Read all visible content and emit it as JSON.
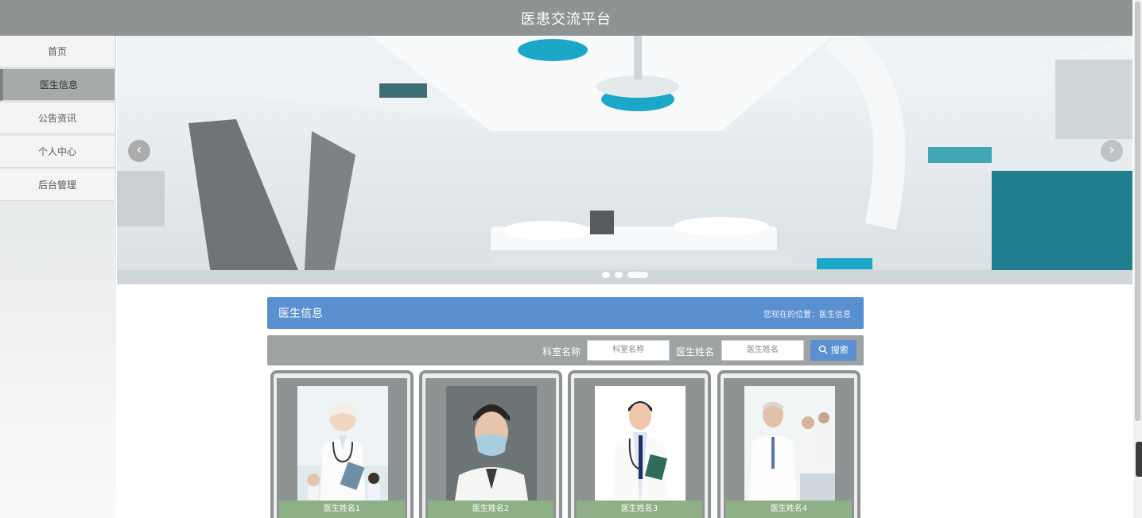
{
  "header": {
    "title": "医患交流平台"
  },
  "sidebar": {
    "items": [
      {
        "label": "首页",
        "active": false
      },
      {
        "label": "医生信息",
        "active": true
      },
      {
        "label": "公告资讯",
        "active": false
      },
      {
        "label": "个人中心",
        "active": false
      },
      {
        "label": "后台管理",
        "active": false
      }
    ]
  },
  "banner": {
    "prev_icon": "chevron-left-icon",
    "next_icon": "chevron-right-icon",
    "slide_count": 3,
    "active_slide": 3
  },
  "section": {
    "title": "医生信息",
    "breadcrumb": "您现在的位置：医生信息"
  },
  "search": {
    "dept_label": "科室名称",
    "dept_placeholder": "科室名称",
    "doctor_label": "医生姓名",
    "doctor_placeholder": "医生姓名",
    "button_label": "搜索",
    "button_icon": "search-icon"
  },
  "doctors": [
    {
      "name": "医生姓名1"
    },
    {
      "name": "医生姓名2"
    },
    {
      "name": "医生姓名3"
    },
    {
      "name": "医生姓名4"
    }
  ],
  "colors": {
    "topbar": "#8e9393",
    "accent": "#5a8fd0",
    "caption": "#8faf86",
    "teal": "#1ba7c7"
  }
}
